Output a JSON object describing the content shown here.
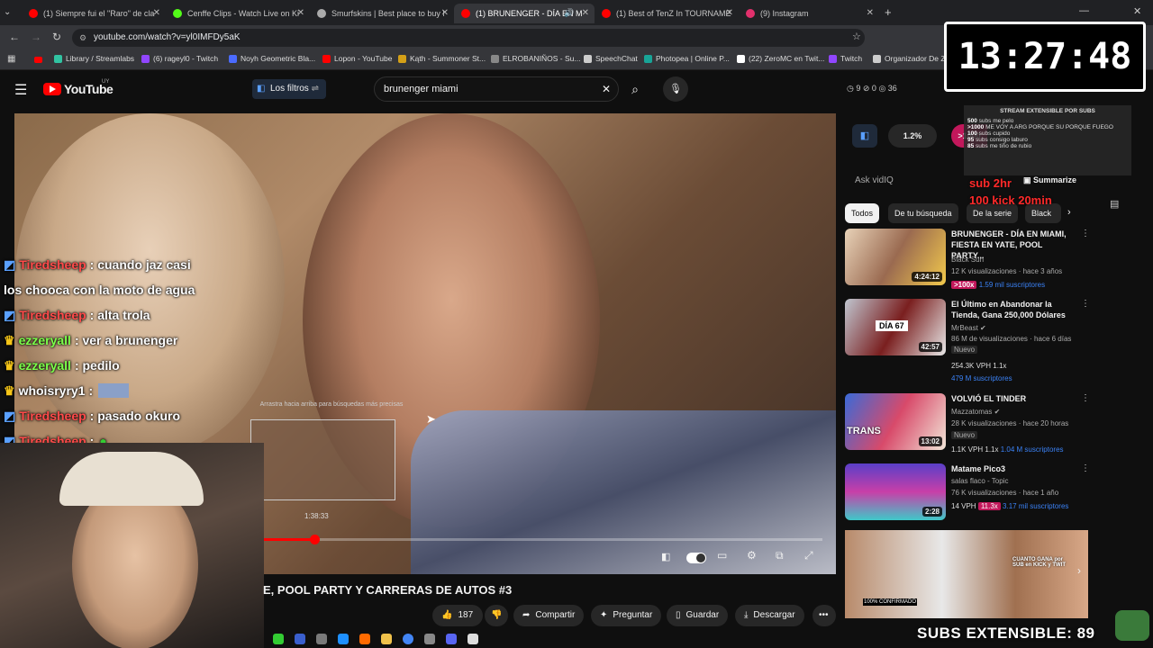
{
  "tabs": [
    {
      "label": "(1) Siempre fui el \"Raro\" de cla",
      "color": "#ff0000"
    },
    {
      "label": "Cenffe Clips - Watch Live on Ki",
      "color": "#53fc18"
    },
    {
      "label": "Smurfskins | Best place to buy l",
      "color": "#aaaaaa"
    },
    {
      "label": "(1) BRUNENGER - DÍA EN M",
      "color": "#ff0000"
    },
    {
      "label": "(1) Best of TenZ In TOURNAME",
      "color": "#ff0000"
    },
    {
      "label": "(9) Instagram",
      "color": "#e1306c"
    }
  ],
  "address": {
    "url": "youtube.com/watch?v=yl0IMFDy5aK"
  },
  "bookmarks": [
    {
      "label": "Library / Streamlabs",
      "color": "#31c3a2"
    },
    {
      "label": "(6) rageyl0 - Twitch",
      "color": "#9146ff"
    },
    {
      "label": "Noyh Geometric Bla...",
      "color": "#4b6bff"
    },
    {
      "label": "Lopon - YouTube",
      "color": "#ff0000"
    },
    {
      "label": "Kąth - Summoner St...",
      "color": "#d4a017"
    },
    {
      "label": "ELROBANIÑOS - Su...",
      "color": "#888888"
    },
    {
      "label": "SpeechChat",
      "color": "#cccccc"
    },
    {
      "label": "Photopea | Online P...",
      "color": "#18a497"
    },
    {
      "label": "(22) ZeroMC en Twit...",
      "color": "#ffffff"
    },
    {
      "label": "Twitch",
      "color": "#9146ff"
    },
    {
      "label": "Organizador De Z",
      "color": "#cccccc"
    }
  ],
  "youtube": {
    "logo": "YouTube",
    "region": "UY",
    "filters_label": "Los filtros",
    "search_value": "brunenger miami",
    "stats": {
      "a": "9",
      "b": "0",
      "c": "36"
    }
  },
  "chat": [
    {
      "user": "Tiredsheep",
      "msg": ": cuando jaz casi",
      "ucolor": "#ff4a4a"
    },
    {
      "user": "",
      "msg": "los chooca con la moto de agua",
      "ucolor": "#ffffff"
    },
    {
      "user": "Tiredsheep",
      "msg": ": alta trola",
      "ucolor": "#ff4a4a"
    },
    {
      "user": "ezzeryall",
      "msg": ": ver a brunenger",
      "ucolor": "#7bff4a"
    },
    {
      "user": "ezzeryall",
      "msg": ": pedilo",
      "ucolor": "#7bff4a"
    },
    {
      "user": "whoisryry1",
      "msg": ":",
      "ucolor": "#ffffff"
    },
    {
      "user": "Tiredsheep",
      "msg": ": pasado okuro",
      "ucolor": "#ff4a4a"
    },
    {
      "user": "Tiredsheep",
      "msg": ":",
      "ucolor": "#ff4a4a"
    }
  ],
  "player": {
    "drag_hint": "Arrastra hacia arriba para búsquedas más precisas",
    "preview_time": "1:38:33",
    "progress_fraction": 0.09
  },
  "video_title": "E, POOL PARTY Y CARRERAS DE AUTOS #3",
  "actions": {
    "likes": "187",
    "share": "Compartir",
    "ask": "Preguntar",
    "save": "Guardar",
    "download": "Descargar"
  },
  "vidiq": {
    "pct1": "1.2%",
    "pct2": ">1000",
    "ask": "Ask vidIQ",
    "summarize": "Summarize"
  },
  "chips": [
    "Todos",
    "De tu búsqueda",
    "De la serie",
    "Black"
  ],
  "recs": [
    {
      "title": "BRUNENGER - DÍA EN MIAMI, FIESTA EN YATE, POOL PARTY...",
      "channel": "Black Sun",
      "meta": "12 K visualizaciones · hace 3 años",
      "badge1": ">100x",
      "badge2": "1.59 mil suscriptores",
      "duration": "4:24:12"
    },
    {
      "title": "El Último en Abandonar la Tienda, Gana 250,000 Dólares",
      "channel": "MrBeast",
      "meta": "86 M de visualizaciones · hace 6 días",
      "new": "Nuevo",
      "badge0": "254.3K VPH",
      "badge1": "1.1x",
      "badge2": "479 M suscriptores",
      "duration": "42:57"
    },
    {
      "title": "VOLVIÓ EL TINDER",
      "channel": "Mazzatomas",
      "meta": "28 K visualizaciones · hace 20 horas",
      "new": "Nuevo",
      "badge0": "1.1K VPH",
      "badge1": "1.1x",
      "badge2": "1.04 M suscriptores",
      "duration": "13:02"
    },
    {
      "title": "Matame Pico3",
      "channel": "salas flaco - Topic",
      "meta": "76 K visualizaciones · hace 1 año",
      "badge0": "14 VPH",
      "badge1": "11.3x",
      "badge2": "3.17 mil suscriptores",
      "duration": "2:28"
    }
  ],
  "overlay": {
    "clock": "13:27:48",
    "subs_title": "STREAM EXTENSIBLE POR SUBS",
    "subs_rows": [
      {
        "n": "500",
        "t": "me pelo"
      },
      {
        "n": ">1000",
        "t": "ME VOY A ARG PORQUE SU PORQUE FUEGO"
      },
      {
        "n": "100",
        "t": "cupido"
      },
      {
        "n": "95",
        "t": "consigo laburo"
      },
      {
        "n": "85",
        "t": "me tiño de rubio"
      }
    ],
    "sub_promo1": "sub 2hr",
    "sub_promo2": "100 kick 20min",
    "footer": "SUBS EXTENSIBLE: 89"
  },
  "thumb_texts": {
    "dia67": "DÍA 67",
    "trans": "TRANS",
    "confirmado": "100% CONFIRMADO",
    "cuanto": "CUANTO GANA por SUB en KICK y TWIT"
  }
}
